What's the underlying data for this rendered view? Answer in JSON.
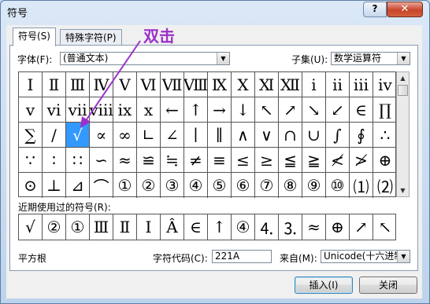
{
  "window": {
    "title": "符号",
    "help": "?",
    "close": "✕"
  },
  "tabs": [
    {
      "label": "符号(S)"
    },
    {
      "label": "特殊字符(P)"
    }
  ],
  "font": {
    "label": "字体(F):",
    "value": "(普通文本)"
  },
  "subset": {
    "label": "子集(U):",
    "value": "数学运算符"
  },
  "symbols": [
    [
      "Ⅰ",
      "Ⅱ",
      "Ⅲ",
      "Ⅳ",
      "Ⅴ",
      "Ⅵ",
      "Ⅶ",
      "Ⅷ",
      "Ⅸ",
      "Ⅹ",
      "Ⅺ",
      "Ⅻ",
      "ⅰ",
      "ⅱ",
      "ⅲ",
      "ⅳ"
    ],
    [
      "ⅴ",
      "ⅵ",
      "ⅶ",
      "ⅷ",
      "ⅸ",
      "ⅹ",
      "←",
      "↑",
      "→",
      "↓",
      "↖",
      "↗",
      "↘",
      "↙",
      "∈",
      "∏"
    ],
    [
      "∑",
      "∕",
      "√",
      "∝",
      "∞",
      "∟",
      "∠",
      "∣",
      "∥",
      "∧",
      "∨",
      "∩",
      "∪",
      "∫",
      "∮",
      "∴"
    ],
    [
      "∵",
      "∶",
      "∷",
      "∽",
      "≈",
      "≌",
      "≒",
      "≠",
      "≡",
      "≤",
      "≥",
      "≦",
      "≧",
      "≮",
      "≯",
      "⊕"
    ],
    [
      "⊙",
      "⊥",
      "⊿",
      "⌒",
      "①",
      "②",
      "③",
      "④",
      "⑤",
      "⑥",
      "⑦",
      "⑧",
      "⑨",
      "⑩",
      "⑴",
      "⑵"
    ]
  ],
  "selected": {
    "row": 2,
    "col": 2
  },
  "recent_label": "近期使用过的符号(R):",
  "recent": [
    "√",
    "②",
    "①",
    "Ⅲ",
    "Ⅱ",
    "Ⅰ",
    "Â",
    "∈",
    "↑",
    "④",
    "⒋",
    "⒊",
    "≈",
    "⊕",
    "↗",
    "↖"
  ],
  "char_name": "平方根",
  "char_code": {
    "label": "字符代码(C):",
    "value": "221A"
  },
  "from": {
    "label": "来自(M):",
    "value": "Unicode(十六进制)"
  },
  "buttons": {
    "insert": "插入(I)",
    "close": "关闭"
  },
  "annotation": {
    "text": "双击",
    "color": "#9b30c8"
  }
}
